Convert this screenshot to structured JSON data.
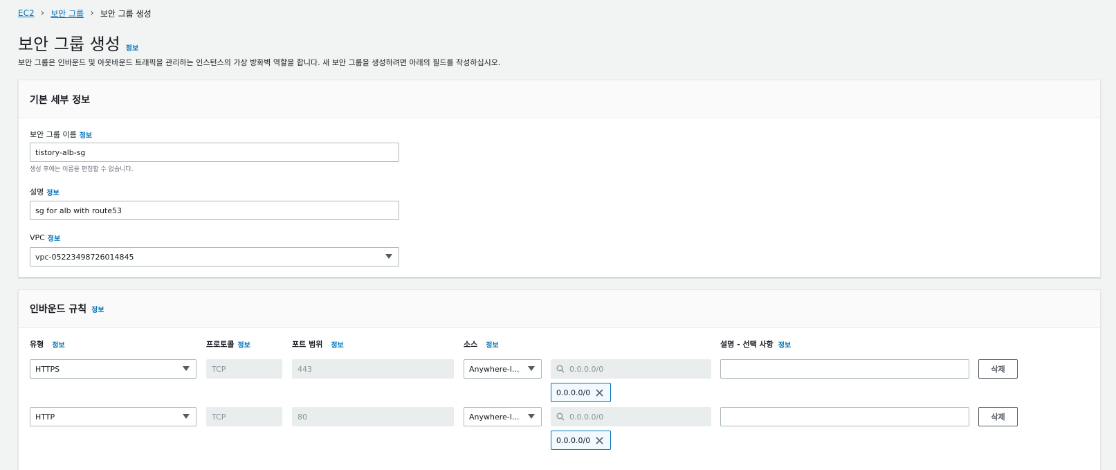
{
  "breadcrumb": {
    "items": [
      "EC2",
      "보안 그룹"
    ],
    "current": "보안 그룹 생성"
  },
  "info_label": "정보",
  "page": {
    "title": "보안 그룹 생성",
    "description": "보안 그룹은 인바운드 및 아웃바운드 트래픽을 관리하는 인스턴스의 가상 방화벽 역할을 합니다. 새 보안 그룹을 생성하려면 아래의 필드를 작성하십시오."
  },
  "basic": {
    "title": "기본 세부 정보",
    "name_label": "보안 그룹 이름",
    "name_value": "tistory-alb-sg",
    "name_hint": "생성 후에는 이름을 편집할 수 없습니다.",
    "desc_label": "설명",
    "desc_value": "sg for alb with route53",
    "vpc_label": "VPC",
    "vpc_value": "vpc-05223498726014845"
  },
  "inbound": {
    "title": "인바운드 규칙",
    "columns": {
      "type": "유형",
      "protocol": "프로토콜",
      "port": "포트 범위",
      "source": "소스",
      "description": "설명 - 선택 사항"
    },
    "rules": [
      {
        "type": "HTTPS",
        "protocol": "TCP",
        "port": "443",
        "source": "Anywhere-I...",
        "cidr_placeholder": "0.0.0.0/0",
        "token": "0.0.0.0/0",
        "description": "",
        "delete_label": "삭제"
      },
      {
        "type": "HTTP",
        "protocol": "TCP",
        "port": "80",
        "source": "Anywhere-I...",
        "cidr_placeholder": "0.0.0.0/0",
        "token": "0.0.0.0/0",
        "description": "",
        "delete_label": "삭제"
      }
    ]
  },
  "icons": {
    "breadcrumb_separator": "chevron-right-icon",
    "dropdown": "caret-down-icon",
    "search": "search-icon",
    "remove_token": "close-icon"
  },
  "colors": {
    "link": "#0073bb",
    "background": "#f2f3f3",
    "token_border": "#0073bb"
  }
}
